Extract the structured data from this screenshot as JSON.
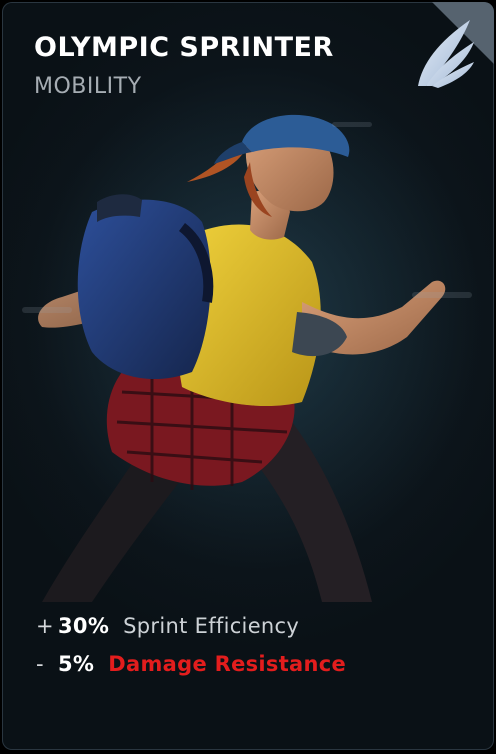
{
  "card": {
    "title": "OLYMPIC SPRINTER",
    "category": "MOBILITY",
    "icon": "wing-icon",
    "stats": [
      {
        "sign": "+",
        "value": "30%",
        "label": "Sprint Efficiency",
        "color": "#cdd2d6"
      },
      {
        "sign": "-",
        "value": "5%",
        "label": "Damage Resistance",
        "color": "#e31d1d"
      }
    ]
  },
  "colors": {
    "background": "#101c23",
    "corner": "#56636f",
    "wing": "#b9cde6",
    "negative": "#e31d1d"
  }
}
